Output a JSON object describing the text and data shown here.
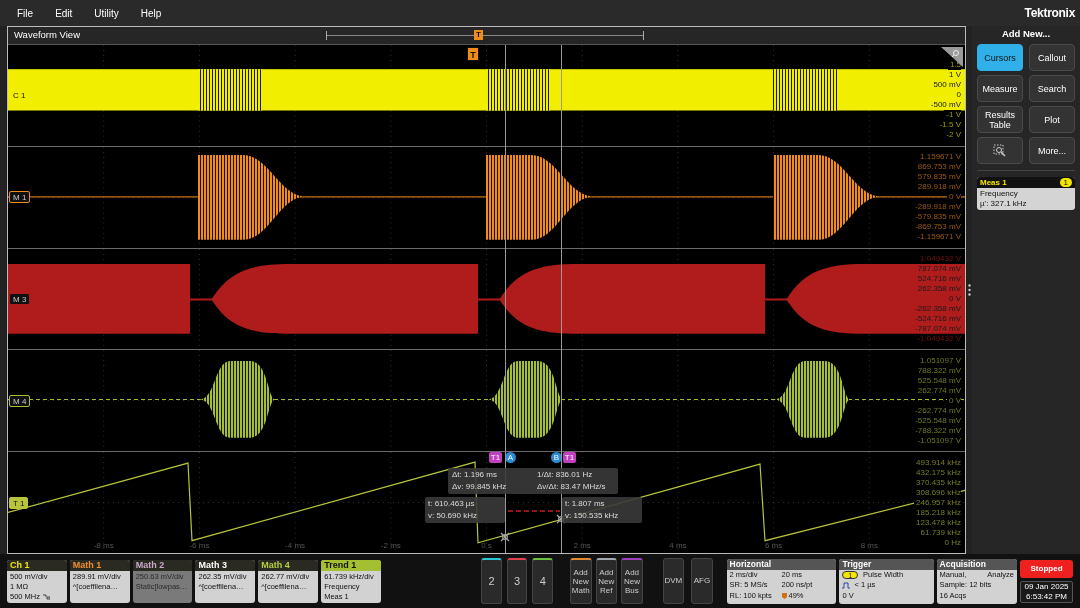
{
  "menu": [
    "File",
    "Edit",
    "Utility",
    "Help"
  ],
  "brand": "Tektronix",
  "waveform_view": {
    "title": "Waveform View",
    "overview_marker": "T",
    "trigger_marker": "T",
    "slices": [
      {
        "label": "C 1",
        "kind": "digital",
        "color": "#f2ee00",
        "highlighted": true,
        "axis_labels": [
          "1.5",
          "1 V",
          "500 mV",
          "0",
          "-500 mV",
          "-1 V",
          "-1.5 V",
          "-2 V"
        ]
      },
      {
        "label": "M 1",
        "kind": "burst",
        "color": "#f08c1a",
        "highlighted": false,
        "axis_labels": [
          "1.159671 V",
          "869.753 mV",
          "579.835 mV",
          "289.918 mV",
          "0 V",
          "-289.918 mV",
          "-579.835 mV",
          "-869.753 mV",
          "-1.159671 V"
        ]
      },
      {
        "label": "M 3",
        "kind": "fill",
        "color": "#b01c1c",
        "highlighted": false,
        "axis_labels": [
          "1.049432 V",
          "787.074 mV",
          "524.716 mV",
          "262.358 mV",
          "0 V",
          "-262.358 mV",
          "-524.716 mV",
          "-787.074 mV",
          "-1.049432 V"
        ]
      },
      {
        "label": "M 4",
        "kind": "bulge",
        "color": "#a4c032",
        "highlighted": false,
        "axis_labels": [
          "1.051097 V",
          "788.322 mV",
          "525.548 mV",
          "262.774 mV",
          "0 V",
          "-262.774 mV",
          "-525.548 mV",
          "-788.322 mV",
          "-1.051097 V"
        ]
      },
      {
        "label": "T 1",
        "kind": "trend",
        "color": "#b8c43a",
        "highlighted": true,
        "axis_labels": [
          "493.914 kHz",
          "432.175 kHz",
          "370.435 kHz",
          "308.696 kHz",
          "246.957 kHz",
          "185.218 kHz",
          "123.478 kHz",
          "61.739 kHz",
          "0 Hz"
        ]
      }
    ],
    "time_labels": [
      "-8 ms",
      "-6 ms",
      "-4 ms",
      "-2 ms",
      "0 s",
      "2 ms",
      "4 ms",
      "6 ms",
      "8 ms"
    ],
    "cursors": {
      "tags": [
        {
          "text": "T1",
          "kind": "source"
        },
        {
          "text": "A",
          "kind": "cursor"
        },
        {
          "text": "B",
          "kind": "cursor"
        },
        {
          "text": "T1",
          "kind": "source"
        }
      ],
      "delta": [
        "Δt: 1.196 ms",
        "1/Δt: 836.01 Hz",
        "Δv: 99.845 kHz",
        "Δv/Δt: 83.47 MHz/s"
      ],
      "a_readout": [
        "t: 610.463 µs",
        "v: 50.690 kHz"
      ],
      "b_readout": [
        "t: 1.807 ms",
        "v: 150.535 kHz"
      ]
    }
  },
  "side_panel": {
    "heading": "Add New...",
    "buttons": [
      {
        "kind": "text",
        "label": "Cursors",
        "selected": true
      },
      {
        "kind": "text",
        "label": "Callout",
        "selected": false
      },
      {
        "kind": "text",
        "label": "Measure",
        "selected": false
      },
      {
        "kind": "text",
        "label": "Search",
        "selected": false
      },
      {
        "kind": "text",
        "label": "Results Table",
        "selected": false
      },
      {
        "kind": "text",
        "label": "Plot",
        "selected": false
      },
      {
        "kind": "zoom",
        "selected": false
      },
      {
        "kind": "text",
        "label": "More...",
        "selected": false
      }
    ],
    "measurement": {
      "title": "Meas 1",
      "source": "1",
      "name": "Frequency",
      "value": "µ': 327.1 kHz"
    }
  },
  "bottom_bar": {
    "channels": [
      {
        "title": "Ch 1",
        "color": "#f2e600",
        "highlighted": false,
        "disabled": false,
        "lines": [
          "500 mV/div",
          "1 MΩ",
          "500 MHz"
        ]
      },
      {
        "title": "Math 1",
        "color": "#f0902a",
        "highlighted": false,
        "disabled": false,
        "lines": [
          "289.91 mV/div",
          "^[coeffilena…"
        ]
      },
      {
        "title": "Math 2",
        "color": "#c9a8c9",
        "highlighted": false,
        "disabled": true,
        "lines": [
          "250.63 mV/div",
          "Static[lowpas…"
        ]
      },
      {
        "title": "Math 3",
        "color": "#ffffff",
        "highlighted": false,
        "disabled": false,
        "lines": [
          "262.35 mV/div",
          "^[coeffilena…"
        ]
      },
      {
        "title": "Math 4",
        "color": "#b4d040",
        "highlighted": false,
        "disabled": false,
        "lines": [
          "262.77 mV/div",
          "^[coeffilena…"
        ]
      },
      {
        "title": "Trend 1",
        "color": "#a4c032",
        "highlighted": true,
        "disabled": false,
        "lines": [
          "61.739 kHz/div",
          "Frequency",
          "Meas 1"
        ]
      }
    ],
    "channel_buttons": [
      {
        "label": "2",
        "color": "#2ac4d4"
      },
      {
        "label": "3",
        "color": "#e04050"
      },
      {
        "label": "4",
        "color": "#6cc040"
      }
    ],
    "add_buttons": [
      {
        "label": "Add New Math",
        "color": "#e08a30"
      },
      {
        "label": "Add New Ref",
        "color": "#a0a8b0"
      },
      {
        "label": "Add New Bus",
        "color": "#a040c0"
      }
    ],
    "tool_buttons": [
      "DVM",
      "AFG"
    ],
    "horizontal": {
      "title": "Horizontal",
      "rows": [
        [
          "2 ms/div",
          "20 ms"
        ],
        [
          "SR: 5 MS/s",
          "200 ns/pt"
        ],
        [
          "RL: 100 kpts",
          "49%"
        ]
      ]
    },
    "trigger": {
      "title": "Trigger",
      "source": "1",
      "type": "Pulse Width",
      "condition": "< 1 µs",
      "level": "0 V"
    },
    "acquisition": {
      "title": "Acquisition",
      "mode": "Manual,",
      "action": "Analyze",
      "sample": "Sample: 12 bits",
      "count": "16 Acqs"
    },
    "run_state": "Stopped",
    "date": "09 Jan 2025",
    "time": "6:53:42 PM"
  }
}
